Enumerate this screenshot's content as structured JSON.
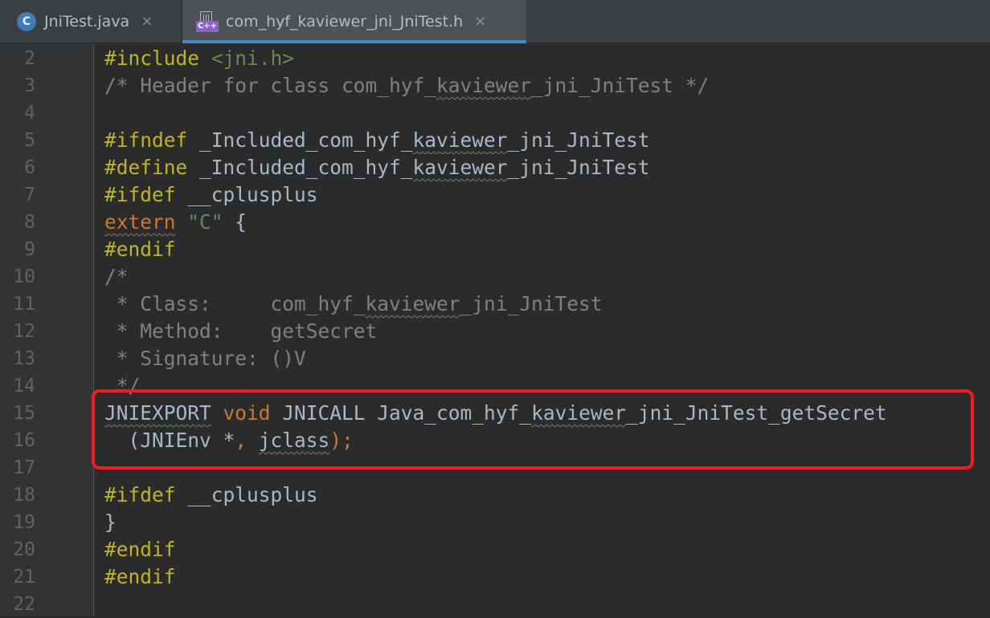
{
  "tabs": [
    {
      "label": "JniTest.java",
      "icon": "java-class-icon",
      "icon_letter": "C",
      "active": false
    },
    {
      "label": "com_hyf_kaviewer_jni_JniTest.h",
      "icon": "cpp-header-file-icon",
      "icon_badge": "C++",
      "active": true
    }
  ],
  "close_glyph": "×",
  "colors": {
    "background": "#2b2b2b",
    "gutter": "#313335",
    "preprocessor": "#bbb529",
    "keyword": "#cc7832",
    "string": "#6a8759",
    "comment": "#808080",
    "text": "#a9b7c6",
    "line_number": "#606366",
    "highlight_border": "#ee1c25",
    "active_tab_underline": "#4a88c7"
  },
  "editor": {
    "lines": [
      {
        "n": "2",
        "tokens": [
          {
            "t": "#include",
            "c": "pp"
          },
          {
            "t": " "
          },
          {
            "t": "<jni.h>",
            "c": "str"
          }
        ]
      },
      {
        "n": "3",
        "tokens": [
          {
            "t": "/* Header for class com_hyf_",
            "c": "cm"
          },
          {
            "t": "kaviewer",
            "c": "cm",
            "sq": true
          },
          {
            "t": "_jni_JniTest */",
            "c": "cm"
          }
        ]
      },
      {
        "n": "4",
        "tokens": []
      },
      {
        "n": "5",
        "tokens": [
          {
            "t": "#ifndef",
            "c": "pp"
          },
          {
            "t": " _Included_com_hyf_"
          },
          {
            "t": "kaviewer",
            "sq": true
          },
          {
            "t": "_jni_JniTest"
          }
        ]
      },
      {
        "n": "6",
        "tokens": [
          {
            "t": "#define",
            "c": "pp"
          },
          {
            "t": " _Included_com_hyf_"
          },
          {
            "t": "kaviewer",
            "sq": true
          },
          {
            "t": "_jni_JniTest"
          }
        ]
      },
      {
        "n": "7",
        "tokens": [
          {
            "t": "#ifdef",
            "c": "pp"
          },
          {
            "t": " __cplusplus"
          }
        ]
      },
      {
        "n": "8",
        "tokens": [
          {
            "t": "extern",
            "c": "kw",
            "sq": true
          },
          {
            "t": " "
          },
          {
            "t": "\"C\"",
            "c": "str"
          },
          {
            "t": " {"
          }
        ]
      },
      {
        "n": "9",
        "tokens": [
          {
            "t": "#endif",
            "c": "pp"
          }
        ]
      },
      {
        "n": "10",
        "tokens": [
          {
            "t": "/*",
            "c": "cm"
          }
        ]
      },
      {
        "n": "11",
        "tokens": [
          {
            "t": " * Class:     com_hyf_",
            "c": "cm"
          },
          {
            "t": "kaviewer",
            "c": "cm",
            "sq": true
          },
          {
            "t": "_jni_JniTest",
            "c": "cm"
          }
        ]
      },
      {
        "n": "12",
        "tokens": [
          {
            "t": " * Method:    getSecret",
            "c": "cm"
          }
        ]
      },
      {
        "n": "13",
        "tokens": [
          {
            "t": " * Signature: ()V",
            "c": "cm"
          }
        ]
      },
      {
        "n": "14",
        "tokens": [
          {
            "t": " */",
            "c": "cm"
          }
        ]
      },
      {
        "n": "15",
        "tokens": [
          {
            "t": "JNIEXPORT",
            "sq": true
          },
          {
            "t": " "
          },
          {
            "t": "void",
            "c": "kw"
          },
          {
            "t": " JNICALL Java_com_hyf_"
          },
          {
            "t": "kaviewer",
            "sq": true
          },
          {
            "t": "_jni_JniTest_getSecret"
          }
        ]
      },
      {
        "n": "16",
        "tokens": [
          {
            "t": "  (JNIEnv *"
          },
          {
            "t": ",",
            "c": "punc"
          },
          {
            "t": " "
          },
          {
            "t": "jclass",
            "sq": true
          },
          {
            "t": ");",
            "c": "punc"
          }
        ]
      },
      {
        "n": "17",
        "tokens": []
      },
      {
        "n": "18",
        "tokens": [
          {
            "t": "#ifdef",
            "c": "pp"
          },
          {
            "t": " __cplusplus"
          }
        ]
      },
      {
        "n": "19",
        "tokens": [
          {
            "t": "}"
          }
        ]
      },
      {
        "n": "20",
        "tokens": [
          {
            "t": "#endif",
            "c": "pp"
          }
        ]
      },
      {
        "n": "21",
        "tokens": [
          {
            "t": "#endif",
            "c": "pp"
          }
        ]
      },
      {
        "n": "22",
        "tokens": []
      }
    ]
  }
}
